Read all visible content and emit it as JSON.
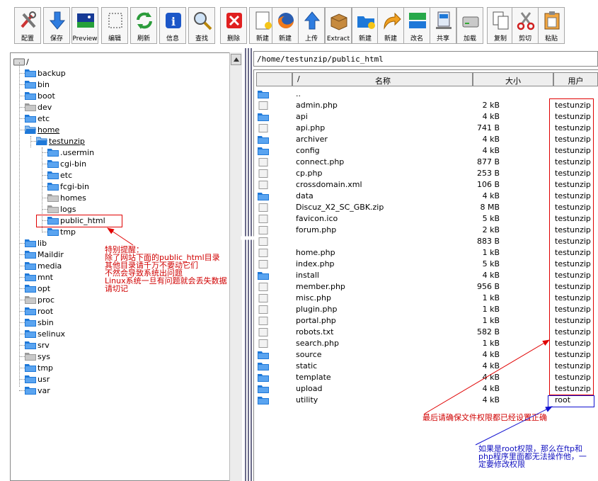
{
  "toolbar": {
    "buttons": [
      {
        "label": "配置",
        "icon": "tools-icon"
      },
      {
        "label": "保存",
        "icon": "download-arrow-icon"
      },
      {
        "label": "Preview",
        "icon": "preview-icon"
      },
      {
        "label": "编辑",
        "icon": "edit-icon"
      },
      {
        "label": "刷新",
        "icon": "refresh-icon"
      },
      {
        "label": "信息",
        "icon": "info-icon"
      },
      {
        "label": "查找",
        "icon": "search-icon"
      },
      {
        "label": "删除",
        "icon": "delete-icon"
      },
      {
        "label": "新建",
        "icon": "new-file-icon"
      },
      {
        "label": "新建",
        "icon": "firefox-icon"
      },
      {
        "label": "上传",
        "icon": "upload-arrow-icon"
      },
      {
        "label": "Extract",
        "icon": "extract-box-icon"
      },
      {
        "label": "新建",
        "icon": "new-folder-icon"
      },
      {
        "label": "新建",
        "icon": "redirect-arrow-icon"
      },
      {
        "label": "改名",
        "icon": "rename-icon"
      },
      {
        "label": "共享",
        "icon": "share-icon"
      },
      {
        "label": "加载",
        "icon": "drive-icon"
      },
      {
        "label": "复制",
        "icon": "copy-icon"
      },
      {
        "label": "剪切",
        "icon": "cut-icon"
      },
      {
        "label": "粘贴",
        "icon": "paste-icon"
      }
    ]
  },
  "tree": {
    "root": "/",
    "items": [
      {
        "label": "backup",
        "level": 1,
        "type": "folder-blue"
      },
      {
        "label": "bin",
        "level": 1,
        "type": "folder-blue"
      },
      {
        "label": "boot",
        "level": 1,
        "type": "folder-blue"
      },
      {
        "label": "dev",
        "level": 1,
        "type": "folder-gray"
      },
      {
        "label": "etc",
        "level": 1,
        "type": "folder-blue"
      },
      {
        "label": "home",
        "level": 1,
        "type": "folder-blue-open"
      },
      {
        "label": "testunzip",
        "level": 2,
        "type": "folder-blue-open"
      },
      {
        "label": ".usermin",
        "level": 3,
        "type": "folder-blue"
      },
      {
        "label": "cgi-bin",
        "level": 3,
        "type": "folder-blue"
      },
      {
        "label": "etc",
        "level": 3,
        "type": "folder-blue"
      },
      {
        "label": "fcgi-bin",
        "level": 3,
        "type": "folder-blue"
      },
      {
        "label": "homes",
        "level": 3,
        "type": "folder-gray"
      },
      {
        "label": "logs",
        "level": 3,
        "type": "folder-gray"
      },
      {
        "label": "public_html",
        "level": 3,
        "type": "folder-blue"
      },
      {
        "label": "tmp",
        "level": 3,
        "type": "folder-blue"
      },
      {
        "label": "lib",
        "level": 1,
        "type": "folder-blue"
      },
      {
        "label": "Maildir",
        "level": 1,
        "type": "folder-blue"
      },
      {
        "label": "media",
        "level": 1,
        "type": "folder-blue"
      },
      {
        "label": "mnt",
        "level": 1,
        "type": "folder-blue"
      },
      {
        "label": "opt",
        "level": 1,
        "type": "folder-blue"
      },
      {
        "label": "proc",
        "level": 1,
        "type": "folder-gray"
      },
      {
        "label": "root",
        "level": 1,
        "type": "folder-blue"
      },
      {
        "label": "sbin",
        "level": 1,
        "type": "folder-blue"
      },
      {
        "label": "selinux",
        "level": 1,
        "type": "folder-blue"
      },
      {
        "label": "srv",
        "level": 1,
        "type": "folder-blue"
      },
      {
        "label": "sys",
        "level": 1,
        "type": "folder-gray"
      },
      {
        "label": "tmp",
        "level": 1,
        "type": "folder-blue"
      },
      {
        "label": "usr",
        "level": 1,
        "type": "folder-blue"
      },
      {
        "label": "var",
        "level": 1,
        "type": "folder-blue"
      }
    ]
  },
  "address": "/home/testunzip/public_html",
  "columns": {
    "slash": "/",
    "name": "名称",
    "size": "大小",
    "user": "用户"
  },
  "files": [
    {
      "name": "..",
      "size": "",
      "owner": "",
      "type": "folder"
    },
    {
      "name": "admin.php",
      "size": "2 kB",
      "owner": "testunzip",
      "type": "file"
    },
    {
      "name": "api",
      "size": "4 kB",
      "owner": "testunzip",
      "type": "folder"
    },
    {
      "name": "api.php",
      "size": "741 B",
      "owner": "testunzip",
      "type": "file"
    },
    {
      "name": "archiver",
      "size": "4 kB",
      "owner": "testunzip",
      "type": "folder"
    },
    {
      "name": "config",
      "size": "4 kB",
      "owner": "testunzip",
      "type": "folder"
    },
    {
      "name": "connect.php",
      "size": "877 B",
      "owner": "testunzip",
      "type": "file"
    },
    {
      "name": "cp.php",
      "size": "253 B",
      "owner": "testunzip",
      "type": "file"
    },
    {
      "name": "crossdomain.xml",
      "size": "106 B",
      "owner": "testunzip",
      "type": "file"
    },
    {
      "name": "data",
      "size": "4 kB",
      "owner": "testunzip",
      "type": "folder"
    },
    {
      "name": "Discuz_X2_SC_GBK.zip",
      "size": "8 MB",
      "owner": "testunzip",
      "type": "file"
    },
    {
      "name": "favicon.ico",
      "size": "5 kB",
      "owner": "testunzip",
      "type": "file"
    },
    {
      "name": "forum.php",
      "size": "2 kB",
      "owner": "testunzip",
      "type": "file"
    },
    {
      "name": "",
      "size": "883 B",
      "owner": "testunzip",
      "type": "file"
    },
    {
      "name": "home.php",
      "size": "1 kB",
      "owner": "testunzip",
      "type": "file"
    },
    {
      "name": "index.php",
      "size": "5 kB",
      "owner": "testunzip",
      "type": "file"
    },
    {
      "name": "install",
      "size": "4 kB",
      "owner": "testunzip",
      "type": "folder"
    },
    {
      "name": "member.php",
      "size": "956 B",
      "owner": "testunzip",
      "type": "file"
    },
    {
      "name": "misc.php",
      "size": "1 kB",
      "owner": "testunzip",
      "type": "file"
    },
    {
      "name": "plugin.php",
      "size": "1 kB",
      "owner": "testunzip",
      "type": "file"
    },
    {
      "name": "portal.php",
      "size": "1 kB",
      "owner": "testunzip",
      "type": "file"
    },
    {
      "name": "robots.txt",
      "size": "582 B",
      "owner": "testunzip",
      "type": "file"
    },
    {
      "name": "search.php",
      "size": "1 kB",
      "owner": "testunzip",
      "type": "file"
    },
    {
      "name": "source",
      "size": "4 kB",
      "owner": "testunzip",
      "type": "folder"
    },
    {
      "name": "static",
      "size": "4 kB",
      "owner": "testunzip",
      "type": "folder"
    },
    {
      "name": "template",
      "size": "4 kB",
      "owner": "testunzip",
      "type": "folder"
    },
    {
      "name": "upload",
      "size": "4 kB",
      "owner": "testunzip",
      "type": "folder"
    },
    {
      "name": "utility",
      "size": "4 kB",
      "owner": "root",
      "type": "folder"
    }
  ],
  "notes": {
    "left": [
      "特别提醒：",
      "除了网站下面的public_html目录",
      "其他目录请千万不要动它们",
      "不然会导致系统出问题",
      "Linux系统一旦有问题就会丢失数据",
      "请切记"
    ],
    "right_red": "最后请确保文件权限都已经设置正确",
    "right_blue": [
      "如果是root权限，那么在ftp和",
      "php程序里面都无法操作他，一",
      "定要修改权限"
    ]
  },
  "colors": {
    "folder_blue": "#1e78d8",
    "folder_gray": "#9a9a9a",
    "annotation_red": "#d00000",
    "annotation_blue": "#1010c0"
  }
}
